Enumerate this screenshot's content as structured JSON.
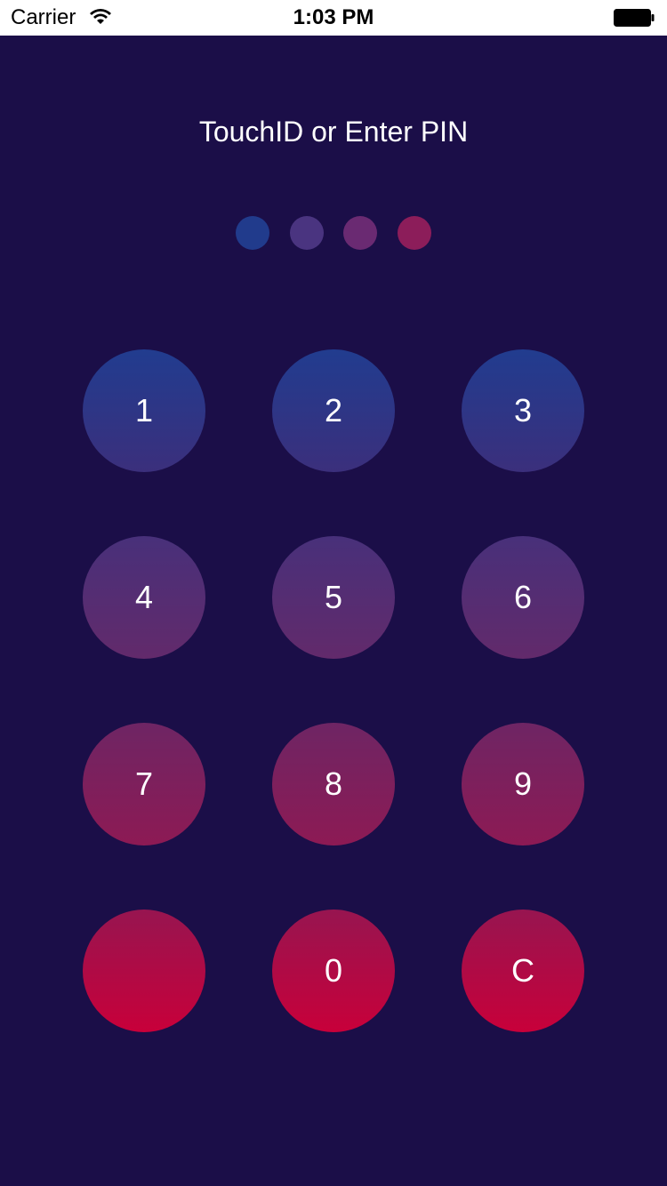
{
  "status_bar": {
    "carrier": "Carrier",
    "time": "1:03 PM",
    "wifi_icon": "wifi-icon",
    "battery_icon": "battery-icon"
  },
  "title": "TouchID or Enter PIN",
  "pin_dots": {
    "count": 4,
    "filled": 0,
    "colors": [
      "#213b8c",
      "#4a3480",
      "#6a2a72",
      "#8c1d5a"
    ]
  },
  "keypad": {
    "keys": [
      {
        "label": "1"
      },
      {
        "label": "2"
      },
      {
        "label": "3"
      },
      {
        "label": "4"
      },
      {
        "label": "5"
      },
      {
        "label": "6"
      },
      {
        "label": "7"
      },
      {
        "label": "8"
      },
      {
        "label": "9"
      },
      {
        "label": "",
        "icon": "touchid-key"
      },
      {
        "label": "0"
      },
      {
        "label": "C"
      }
    ],
    "row_colors": [
      [
        "#213c8f",
        "#3b2f7c"
      ],
      [
        "#48307a",
        "#622a6b"
      ],
      [
        "#6e2564",
        "#8d1a54"
      ],
      [
        "#971550",
        "#c8003a"
      ]
    ]
  },
  "colors": {
    "background": "#1b0e48",
    "text": "#ffffff"
  }
}
